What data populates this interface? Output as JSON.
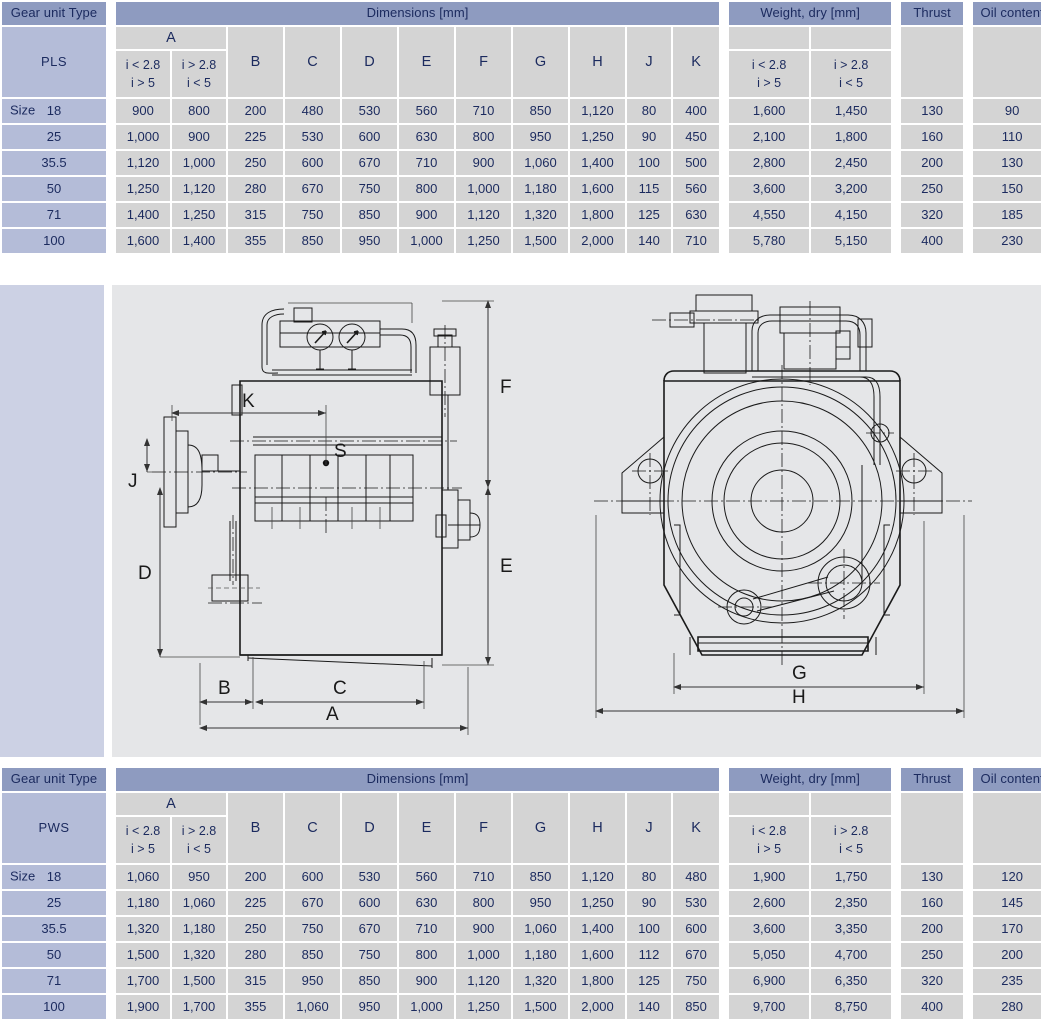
{
  "tables": [
    {
      "id": "pls",
      "type_label": "PLS",
      "groups": {
        "gear_unit_type": "Gear unit Type",
        "dimensions": "Dimensions [mm]",
        "weight": "Weight, dry [mm]",
        "thrust": "Thrust",
        "oil_content": "Oil content"
      },
      "letters": [
        "A",
        "B",
        "C",
        "D",
        "E",
        "F",
        "G",
        "H",
        "J",
        "K"
      ],
      "ratio_sub": [
        {
          "line1": "i < 2.8",
          "line2": "i > 5"
        },
        {
          "line1": "i > 2.8",
          "line2": "i < 5"
        }
      ],
      "size_prefix": "Size",
      "rows": [
        {
          "size": "18",
          "A1": "900",
          "A2": "800",
          "B": "200",
          "C": "480",
          "D": "530",
          "E": "560",
          "F": "710",
          "G": "850",
          "H": "1,120",
          "J": "80",
          "K": "400",
          "W1": "1,600",
          "W2": "1,450",
          "thrust": "130",
          "oil": "90"
        },
        {
          "size": "25",
          "A1": "1,000",
          "A2": "900",
          "B": "225",
          "C": "530",
          "D": "600",
          "E": "630",
          "F": "800",
          "G": "950",
          "H": "1,250",
          "J": "90",
          "K": "450",
          "W1": "2,100",
          "W2": "1,800",
          "thrust": "160",
          "oil": "110"
        },
        {
          "size": "35.5",
          "A1": "1,120",
          "A2": "1,000",
          "B": "250",
          "C": "600",
          "D": "670",
          "E": "710",
          "F": "900",
          "G": "1,060",
          "H": "1,400",
          "J": "100",
          "K": "500",
          "W1": "2,800",
          "W2": "2,450",
          "thrust": "200",
          "oil": "130"
        },
        {
          "size": "50",
          "A1": "1,250",
          "A2": "1,120",
          "B": "280",
          "C": "670",
          "D": "750",
          "E": "800",
          "F": "1,000",
          "G": "1,180",
          "H": "1,600",
          "J": "115",
          "K": "560",
          "W1": "3,600",
          "W2": "3,200",
          "thrust": "250",
          "oil": "150"
        },
        {
          "size": "71",
          "A1": "1,400",
          "A2": "1,250",
          "B": "315",
          "C": "750",
          "D": "850",
          "E": "900",
          "F": "1,120",
          "G": "1,320",
          "H": "1,800",
          "J": "125",
          "K": "630",
          "W1": "4,550",
          "W2": "4,150",
          "thrust": "320",
          "oil": "185"
        },
        {
          "size": "100",
          "A1": "1,600",
          "A2": "1,400",
          "B": "355",
          "C": "850",
          "D": "950",
          "E": "1,000",
          "F": "1,250",
          "G": "1,500",
          "H": "2,000",
          "J": "140",
          "K": "710",
          "W1": "5,780",
          "W2": "5,150",
          "thrust": "400",
          "oil": "230"
        }
      ]
    },
    {
      "id": "pws",
      "type_label": "PWS",
      "groups": {
        "gear_unit_type": "Gear unit Type",
        "dimensions": "Dimensions [mm]",
        "weight": "Weight, dry [mm]",
        "thrust": "Thrust",
        "oil_content": "Oil content"
      },
      "letters": [
        "A",
        "B",
        "C",
        "D",
        "E",
        "F",
        "G",
        "H",
        "J",
        "K"
      ],
      "ratio_sub": [
        {
          "line1": "i < 2.8",
          "line2": "i > 5"
        },
        {
          "line1": "i > 2.8",
          "line2": "i < 5"
        }
      ],
      "size_prefix": "Size",
      "rows": [
        {
          "size": "18",
          "A1": "1,060",
          "A2": "950",
          "B": "200",
          "C": "600",
          "D": "530",
          "E": "560",
          "F": "710",
          "G": "850",
          "H": "1,120",
          "J": "80",
          "K": "480",
          "W1": "1,900",
          "W2": "1,750",
          "thrust": "130",
          "oil": "120"
        },
        {
          "size": "25",
          "A1": "1,180",
          "A2": "1,060",
          "B": "225",
          "C": "670",
          "D": "600",
          "E": "630",
          "F": "800",
          "G": "950",
          "H": "1,250",
          "J": "90",
          "K": "530",
          "W1": "2,600",
          "W2": "2,350",
          "thrust": "160",
          "oil": "145"
        },
        {
          "size": "35.5",
          "A1": "1,320",
          "A2": "1,180",
          "B": "250",
          "C": "750",
          "D": "670",
          "E": "710",
          "F": "900",
          "G": "1,060",
          "H": "1,400",
          "J": "100",
          "K": "600",
          "W1": "3,600",
          "W2": "3,350",
          "thrust": "200",
          "oil": "170"
        },
        {
          "size": "50",
          "A1": "1,500",
          "A2": "1,320",
          "B": "280",
          "C": "850",
          "D": "750",
          "E": "800",
          "F": "1,000",
          "G": "1,180",
          "H": "1,600",
          "J": "112",
          "K": "670",
          "W1": "5,050",
          "W2": "4,700",
          "thrust": "250",
          "oil": "200"
        },
        {
          "size": "71",
          "A1": "1,700",
          "A2": "1,500",
          "B": "315",
          "C": "950",
          "D": "850",
          "E": "900",
          "F": "1,120",
          "G": "1,320",
          "H": "1,800",
          "J": "125",
          "K": "750",
          "W1": "6,900",
          "W2": "6,350",
          "thrust": "320",
          "oil": "235"
        },
        {
          "size": "100",
          "A1": "1,900",
          "A2": "1,700",
          "B": "355",
          "C": "1,060",
          "D": "950",
          "E": "1,000",
          "F": "1,250",
          "G": "1,500",
          "H": "2,000",
          "J": "140",
          "K": "850",
          "W1": "9,700",
          "W2": "8,750",
          "thrust": "400",
          "oil": "280"
        }
      ]
    }
  ],
  "drawing": {
    "side_view_labels": [
      "K",
      "S",
      "J",
      "D",
      "B",
      "C",
      "A",
      "F",
      "E"
    ],
    "front_view_labels": [
      "G",
      "H"
    ],
    "labels": {
      "A": "A",
      "B": "B",
      "C": "C",
      "D": "D",
      "E": "E",
      "F": "F",
      "G": "G",
      "H": "H",
      "J": "J",
      "K": "K",
      "S": "S"
    }
  },
  "colors": {
    "band": "#8e9bc0",
    "type_cell": "#b4bcd8",
    "sub_cell": "#d4d4d4",
    "data_cell": "#d4d4d4",
    "text": "#1b2a5e",
    "left_panel": "#ccd1e4",
    "canvas": "#e5e6e8"
  }
}
